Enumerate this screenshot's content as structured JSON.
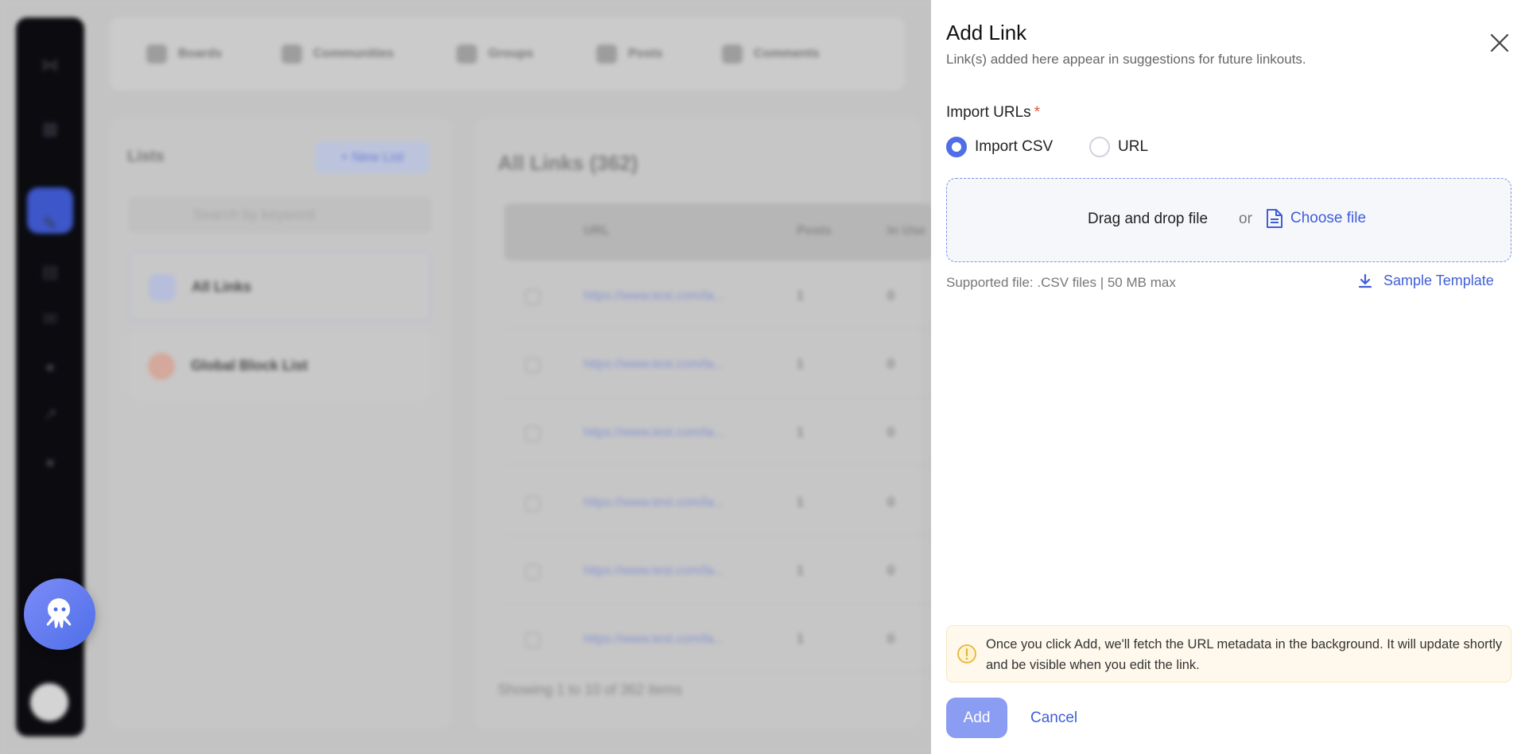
{
  "background": {
    "topbar_tabs": [
      "Boards",
      "Communities",
      "Groups",
      "Posts",
      "Comments"
    ],
    "left_panel": {
      "title": "Lists",
      "new_list_label": "+ New List",
      "search_placeholder": "Search by keyword",
      "items": [
        "All Links",
        "Global Block List"
      ]
    },
    "main_panel": {
      "title": "All Links (362)",
      "columns": [
        "URL",
        "Posts",
        "In Use"
      ],
      "rows": [
        {
          "url": "https://www.test.com/la...",
          "posts": "1",
          "in_use": "0"
        },
        {
          "url": "https://www.test.com/la...",
          "posts": "1",
          "in_use": "0"
        },
        {
          "url": "https://www.test.com/la...",
          "posts": "1",
          "in_use": "0"
        },
        {
          "url": "https://www.test.com/la...",
          "posts": "1",
          "in_use": "0"
        },
        {
          "url": "https://www.test.com/la...",
          "posts": "1",
          "in_use": "0"
        },
        {
          "url": "https://www.test.com/la...",
          "posts": "1",
          "in_use": "0"
        }
      ],
      "footer": "Showing 1 to 10 of 362 items"
    }
  },
  "drawer": {
    "title": "Add Link",
    "subtitle": "Link(s) added here appear in suggestions for future linkouts.",
    "import_label": "Import URLs",
    "required_mark": "*",
    "options": [
      {
        "label": "Import CSV",
        "selected": true
      },
      {
        "label": "URL",
        "selected": false
      }
    ],
    "dropzone": {
      "drag_text": "Drag and drop file",
      "or_text": "or",
      "choose_text": "Choose file"
    },
    "supported_text": "Supported file: .CSV files | 50 MB max",
    "sample_template_label": "Sample Template",
    "notice": "Once you click Add, we'll fetch the URL metadata in the background. It will update shortly and be visible when you edit the link.",
    "add_label": "Add",
    "cancel_label": "Cancel"
  },
  "colors": {
    "accent": "#3f5ed8",
    "radio_selected": "#4f6ee8",
    "add_button": "#8b9df2",
    "required": "#e2533a",
    "notice_bg": "#fef9ec"
  }
}
